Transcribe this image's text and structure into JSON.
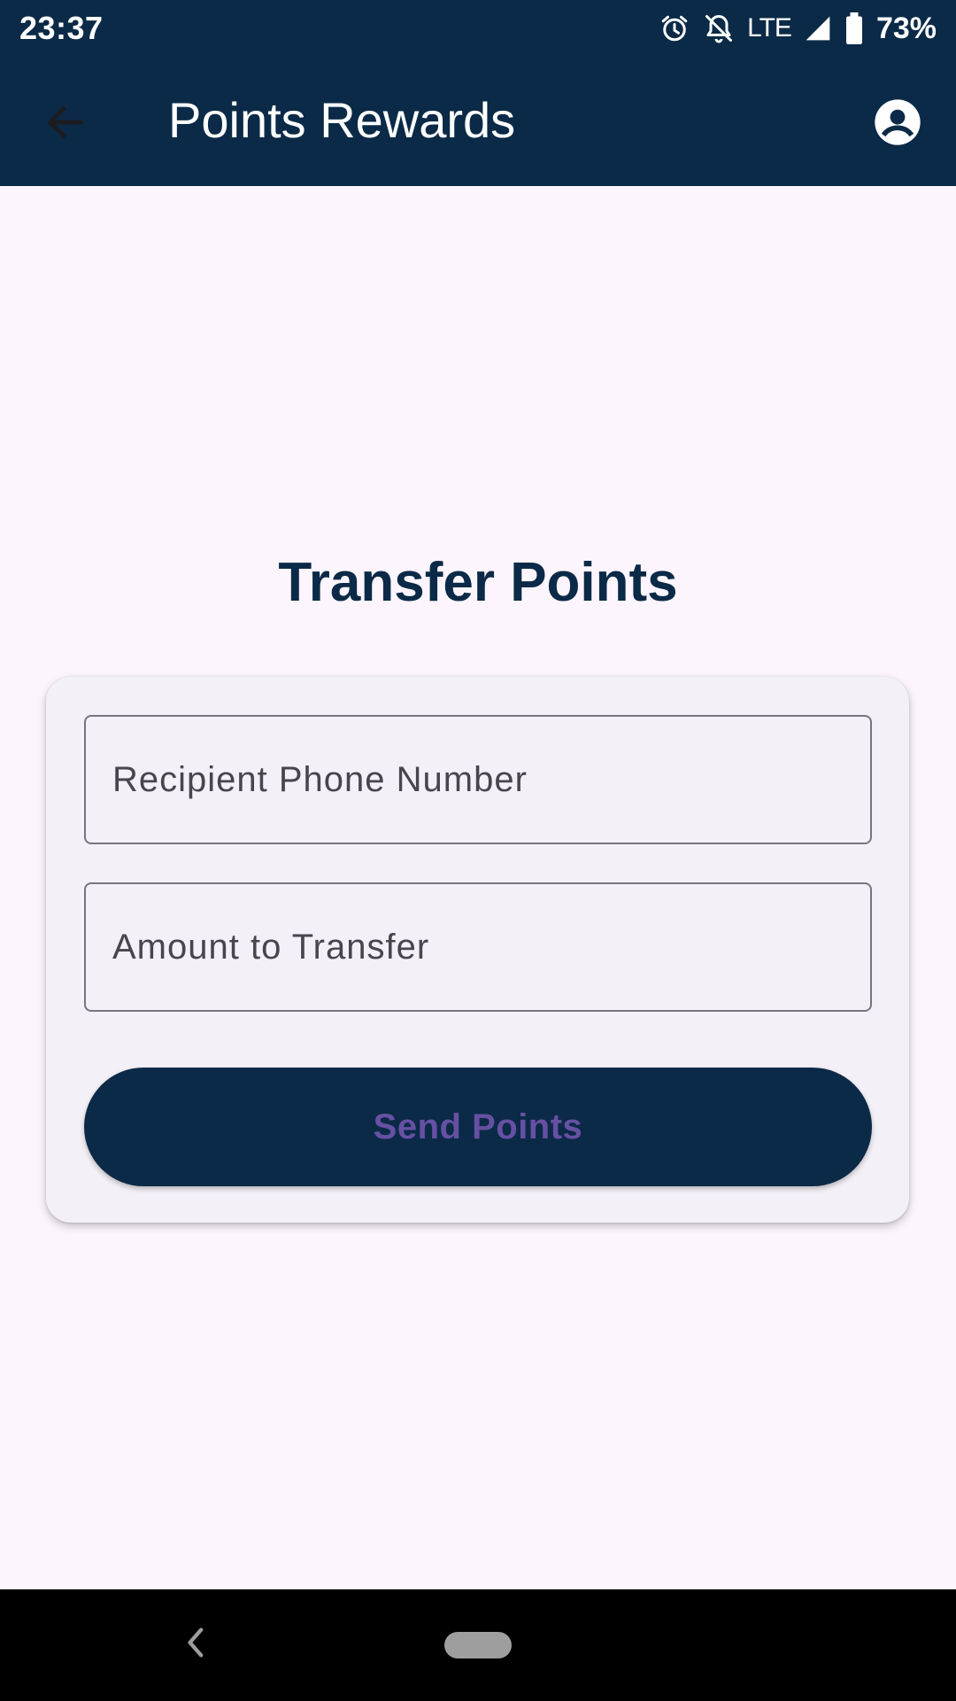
{
  "status_bar": {
    "time": "23:37",
    "network": "LTE",
    "battery": "73%",
    "icons": [
      "alarm-icon",
      "notifications-off-icon",
      "signal-icon",
      "battery-icon"
    ]
  },
  "app_bar": {
    "title": "Points Rewards",
    "back_icon": "arrow-back-icon",
    "account_icon": "account-circle-icon"
  },
  "main": {
    "heading": "Transfer Points",
    "form": {
      "phone_field": {
        "value": "",
        "placeholder": "Recipient Phone Number"
      },
      "amount_field": {
        "value": "",
        "placeholder": "Amount to Transfer"
      },
      "submit_label": "Send Points"
    }
  },
  "nav_bar": {
    "back_icon": "nav-back-icon",
    "home_icon": "home-pill-icon"
  },
  "colors": {
    "primary": "#0b2a47",
    "background": "#fcf5fd",
    "card": "#f4f0f7",
    "button_text": "#6750a4",
    "outline": "#79747e"
  }
}
